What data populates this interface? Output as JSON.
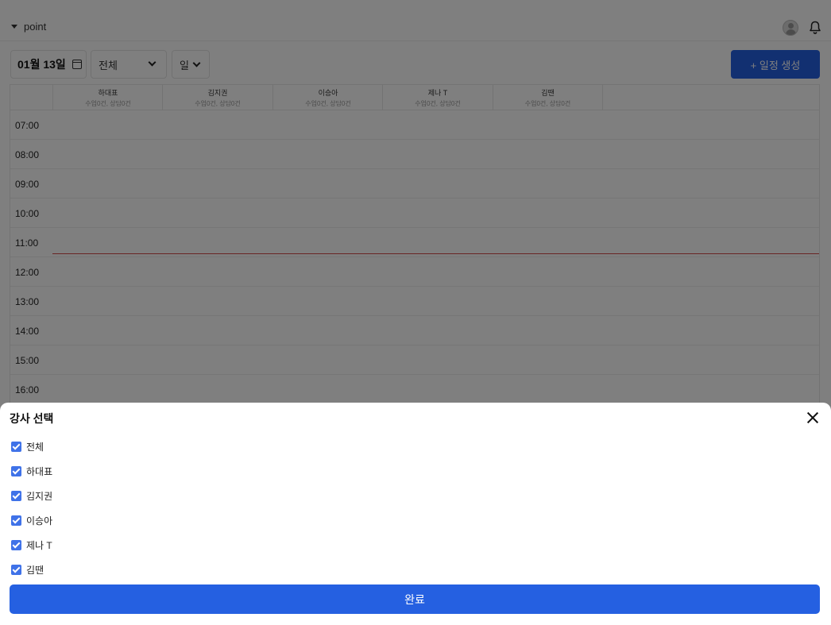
{
  "header": {
    "workspace": "point"
  },
  "toolbar": {
    "date": "01월 13일",
    "filter_value": "전체",
    "view_value": "일",
    "create_label": "+ 일정 생성"
  },
  "instructors": [
    {
      "name": "하대표",
      "summary": "수업0건, 상담0건"
    },
    {
      "name": "김지권",
      "summary": "수업0건, 상담0건"
    },
    {
      "name": "이승아",
      "summary": "수업0건, 상담0건"
    },
    {
      "name": "제나 T",
      "summary": "수업0건, 상담0건"
    },
    {
      "name": "김땐",
      "summary": "수업0건, 상담0건"
    }
  ],
  "times": [
    "07:00",
    "08:00",
    "09:00",
    "10:00",
    "11:00",
    "12:00",
    "13:00",
    "14:00",
    "15:00",
    "16:00"
  ],
  "sheet": {
    "title": "강사 선택",
    "options": [
      {
        "label": "전체",
        "checked": true
      },
      {
        "label": "하대표",
        "checked": true
      },
      {
        "label": "김지권",
        "checked": true
      },
      {
        "label": "이승아",
        "checked": true
      },
      {
        "label": "제나 T",
        "checked": true
      },
      {
        "label": "김땐",
        "checked": true
      }
    ],
    "confirm_label": "완료"
  },
  "colors": {
    "primary": "#2560e1",
    "checkbox": "#3f72e8",
    "now_line": "#d24a4a"
  }
}
